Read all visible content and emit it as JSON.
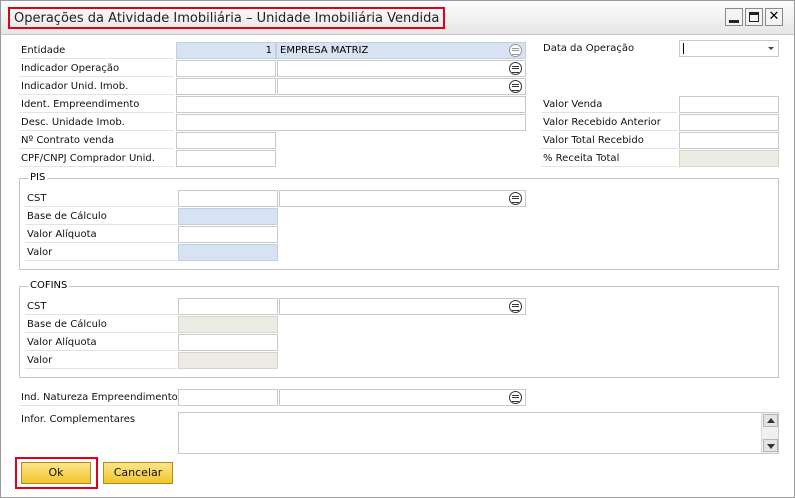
{
  "window": {
    "title": "Operações da Atividade Imobiliária – Unidade Imobiliária Vendida",
    "min_glyph": "",
    "close_glyph": "✕"
  },
  "header_fields": {
    "entidade": {
      "label": "Entidade",
      "code": "1",
      "name": "EMPRESA MATRIZ"
    },
    "indicador_operacao": {
      "label": "Indicador Operação",
      "value": ""
    },
    "indicador_unid": {
      "label": "Indicador Unid. Imob.",
      "value": ""
    },
    "ident_empreendimento": {
      "label": "Ident. Empreendimento",
      "value": ""
    },
    "desc_unidade": {
      "label": "Desc. Unidade Imob.",
      "value": ""
    },
    "contrato_venda": {
      "label": "Nº Contrato venda",
      "value": ""
    },
    "cpf_cnpj": {
      "label": "CPF/CNPJ Comprador Unid.",
      "value": ""
    }
  },
  "right_fields": {
    "data_operacao": {
      "label": "Data da Operação",
      "value": ""
    },
    "valor_venda": {
      "label": "Valor Venda",
      "value": ""
    },
    "valor_recebido_anterior": {
      "label": "Valor Recebido Anterior",
      "value": ""
    },
    "valor_total_recebido": {
      "label": "Valor Total Recebido",
      "value": ""
    },
    "receita_total": {
      "label": "% Receita Total",
      "value": ""
    }
  },
  "pis": {
    "title": "PIS",
    "cst_label": "CST",
    "base_label": "Base de Cálculo",
    "aliquota_label": "Valor Alíquota",
    "valor_label": "Valor"
  },
  "cofins": {
    "title": "COFINS",
    "cst_label": "CST",
    "base_label": "Base de Cálculo",
    "aliquota_label": "Valor Alíquota",
    "valor_label": "Valor"
  },
  "natureza": {
    "label": "Ind. Natureza Empreendimento",
    "value": ""
  },
  "complementares": {
    "label": "Infor. Complementares",
    "value": ""
  },
  "buttons": {
    "ok": "Ok",
    "cancel": "Cancelar"
  },
  "colors": {
    "highlight": "#e0001a",
    "button": "#f2c52e",
    "readonly_blue": "#d7e3f2",
    "readonly_beige": "#ecebe4"
  }
}
